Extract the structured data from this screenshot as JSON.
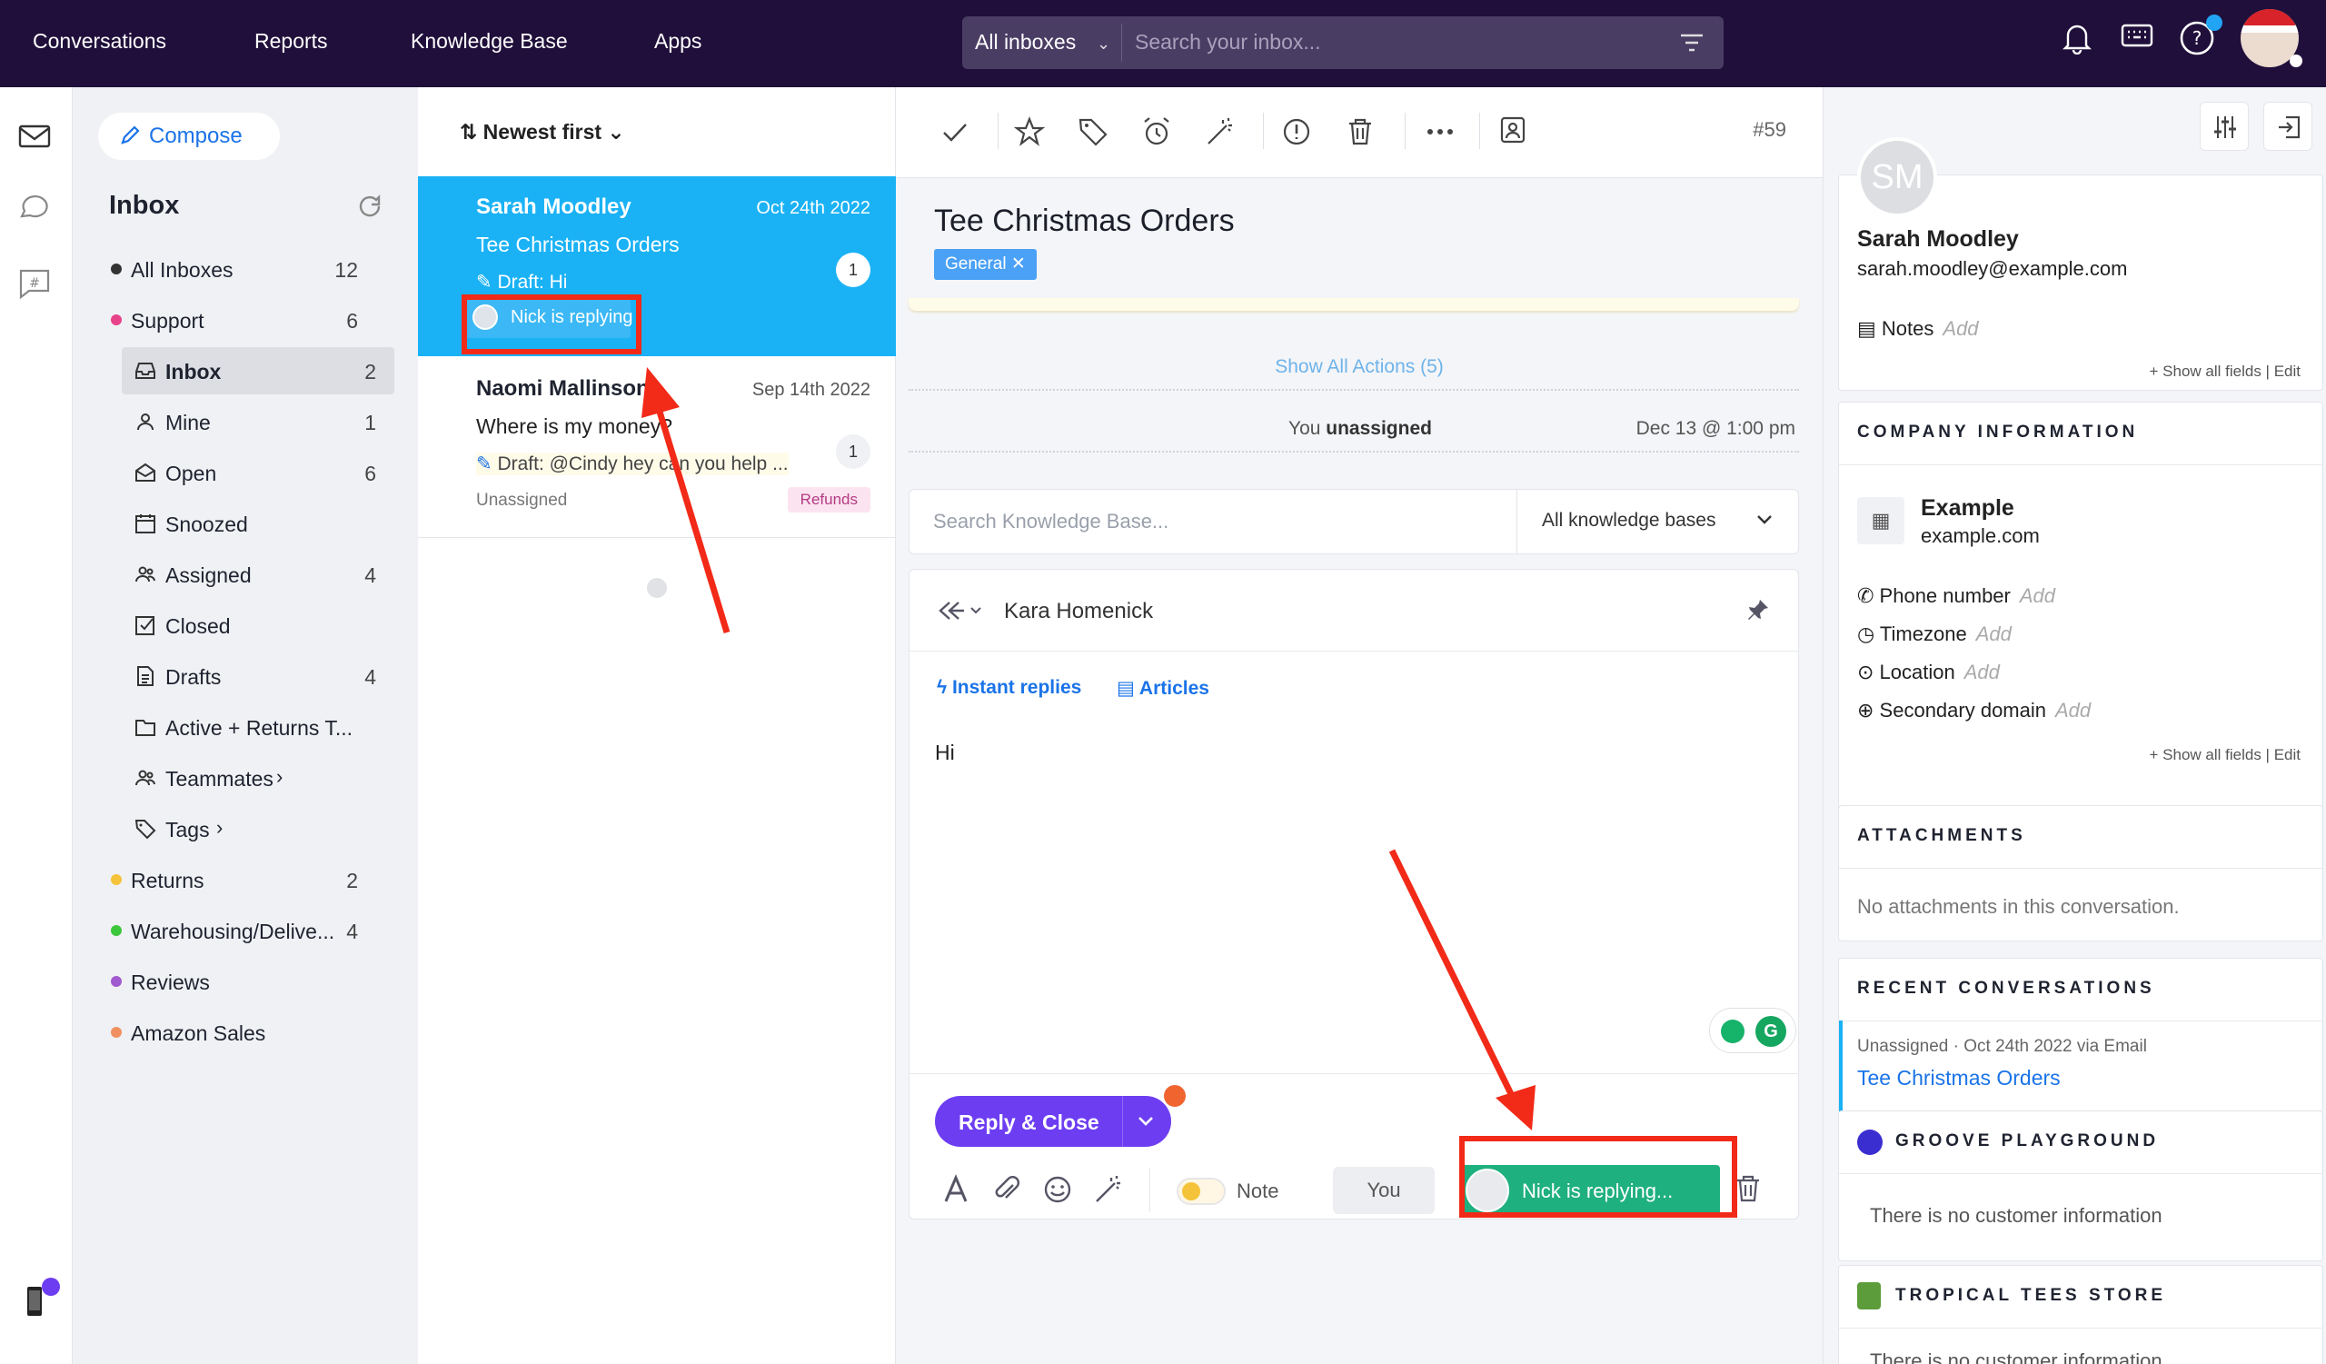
{
  "nav": {
    "items": [
      "Conversations",
      "Reports",
      "Knowledge Base",
      "Apps"
    ],
    "search_scope": "All inboxes",
    "search_placeholder": "Search your inbox..."
  },
  "sidebar": {
    "compose": "Compose",
    "title": "Inbox",
    "folders": [
      {
        "name": "All Inboxes",
        "count": "12",
        "color": "#333333"
      },
      {
        "name": "Support",
        "count": "6",
        "color": "#e8428a"
      },
      {
        "name": "Returns",
        "count": "2",
        "color": "#f5c33a"
      },
      {
        "name": "Warehousing/Delive...",
        "count": "4",
        "color": "#3cc63c"
      },
      {
        "name": "Reviews",
        "count": "",
        "color": "#a05ad0"
      },
      {
        "name": "Amazon Sales",
        "count": "",
        "color": "#f09060"
      }
    ],
    "subfolders": [
      {
        "name": "Inbox",
        "count": "2",
        "icon": "inbox-icon"
      },
      {
        "name": "Mine",
        "count": "1",
        "icon": "user-icon"
      },
      {
        "name": "Open",
        "count": "6",
        "icon": "envelope-open-icon"
      },
      {
        "name": "Snoozed",
        "count": "",
        "icon": "calendar-icon"
      },
      {
        "name": "Assigned",
        "count": "4",
        "icon": "users-icon"
      },
      {
        "name": "Closed",
        "count": "",
        "icon": "checkbox-icon"
      },
      {
        "name": "Drafts",
        "count": "4",
        "icon": "document-icon"
      },
      {
        "name": "Active + Returns T...",
        "count": "",
        "icon": "folder-icon"
      },
      {
        "name": "Teammates",
        "count": "",
        "icon": "users-icon"
      },
      {
        "name": "Tags",
        "count": "",
        "icon": "tag-icon"
      }
    ]
  },
  "list": {
    "sort": "Newest first",
    "conversations": [
      {
        "from": "Sarah Moodley",
        "date": "Oct 24th 2022",
        "subject": "Tee Christmas Orders",
        "draft": "Draft: Hi",
        "count": "1",
        "replying": "Nick is replying"
      },
      {
        "from": "Naomi Mallinson",
        "date": "Sep 14th 2022",
        "subject": "Where is my money?",
        "draft": "Draft: @Cindy hey can you help ...",
        "count": "1",
        "status": "Unassigned",
        "tag": "Refunds"
      }
    ]
  },
  "conversation": {
    "number": "#59",
    "title": "Tee Christmas Orders",
    "label": "General",
    "show_actions": "Show All Actions (5)",
    "event_prefix": "You",
    "event_bold": "unassigned",
    "event_time": "Dec 13 @ 1:00 pm",
    "kb_placeholder": "Search Knowledge Base...",
    "kb_select": "All knowledge bases",
    "to_name": "Kara Homenick",
    "instant_replies": "Instant replies",
    "articles": "Articles",
    "body": "Hi",
    "reply_close": "Reply & Close",
    "note": "Note",
    "you": "You",
    "nick_replying": "Nick is replying..."
  },
  "customer": {
    "initials": "SM",
    "name": "Sarah Moodley",
    "email": "sarah.moodley@example.com",
    "notes_label": "Notes",
    "add": "Add",
    "show_all": "+ Show all fields",
    "edit": "Edit",
    "company_head": "COMPANY INFORMATION",
    "company_name": "Example",
    "company_domain": "example.com",
    "company_fields": [
      "Phone number",
      "Timezone",
      "Location",
      "Secondary domain"
    ],
    "attachments_head": "ATTACHMENTS",
    "attachments_empty": "No attachments in this conversation.",
    "recent_head": "RECENT CONVERSATIONS",
    "recent_meta": "Unassigned · Oct 24th 2022 via Email",
    "recent_title": "Tee Christmas Orders",
    "groove_head": "GROOVE PLAYGROUND",
    "groove_empty": "There is no customer information",
    "tropical_head": "TROPICAL TEES STORE",
    "tropical_empty": "There is no customer information"
  },
  "colors": {
    "topbar": "#200f3a",
    "selected": "#1ab2f5",
    "primary": "#6d3df2",
    "replying_green": "#1fb07f",
    "annotation_red": "#f22a18"
  }
}
